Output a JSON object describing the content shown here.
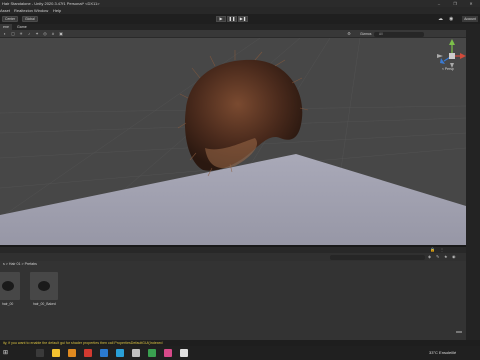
{
  "window": {
    "title": "Hair Standalone - Unity 2020.3.47f1 Personal* <DX11>",
    "controls": [
      "–",
      "❐",
      "✕"
    ]
  },
  "menu": [
    "Asset",
    "Realtezion",
    "Window",
    "Help"
  ],
  "toolbar": {
    "left_buttons": [
      "Center",
      "Global"
    ],
    "play_icons": [
      "▶",
      "❚❚",
      "▶❚"
    ],
    "account_label": "Account",
    "cloud_icon": "cloud-icon",
    "collab_icon": "collab-icon"
  },
  "tabs": [
    "ene",
    "Game"
  ],
  "scene_tools": {
    "gizmos_label": "Gizmos",
    "search_placeholder": "All"
  },
  "gizmo": {
    "label": "< Persp"
  },
  "project": {
    "breadcrumb": "s > Hair 01 > Prefabs",
    "assets": [
      {
        "label": "hair_00"
      },
      {
        "label": "hair_00_Baked"
      }
    ]
  },
  "status": {
    "message": "ity, if you want to enable the default gui for shader properties then call PropertiesDefaultGUI(Indexed"
  },
  "taskbar": {
    "weather": "33°C  Ensoleillé"
  },
  "colors": {
    "scene_bg": "#474747",
    "floor": "#9e9ead",
    "hair": "#5a3322",
    "warning": "#d8c040"
  }
}
